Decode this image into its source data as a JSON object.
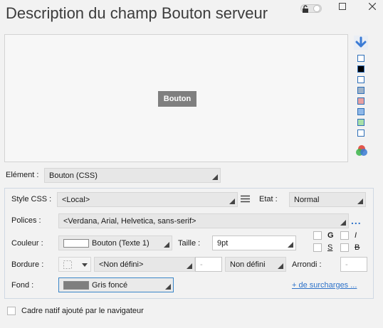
{
  "window": {
    "title": "Description du champ Bouton serveur"
  },
  "preview": {
    "button_label": "Bouton"
  },
  "colors": {
    "swatches": [
      "#ffffff",
      "#000000",
      "#ffffff",
      "#9fb3c8",
      "#e8a0a0",
      "#8fb8e8",
      "#a8e0a8",
      "#ffffff"
    ],
    "preview_button_bg": "#7f7f7f",
    "accent": "#2d72c9"
  },
  "element": {
    "label": "Elément :",
    "value": "Bouton (CSS)"
  },
  "style": {
    "css_label": "Style CSS :",
    "css_value": "<Local>",
    "etat_label": "Etat :",
    "etat_value": "Normal"
  },
  "font": {
    "polices_label": "Polices :",
    "polices_value": "<Verdana, Arial, Helvetica, sans-serif>",
    "couleur_label": "Couleur :",
    "couleur_value": "Bouton (Texte 1)",
    "taille_label": "Taille :",
    "taille_value": "9pt",
    "bold": "G",
    "italic": "I",
    "underline": "S",
    "strike": "B"
  },
  "border": {
    "label": "Bordure :",
    "style_value": "<Non défini>",
    "width_value": "-",
    "type_value": "Non défini",
    "arrondi_label": "Arrondi :",
    "arrondi_value": "-"
  },
  "background": {
    "label": "Fond :",
    "value": "Gris foncé",
    "link": "+ de surcharges ..."
  },
  "native_frame": {
    "label": "Cadre natif ajouté par le navigateur"
  }
}
